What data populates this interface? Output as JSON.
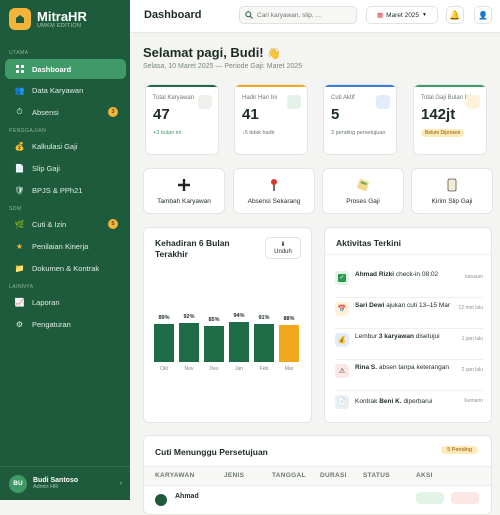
{
  "brand": {
    "name": "MitraHR",
    "sub": "UMKM EDITION"
  },
  "sidebar": {
    "sections": {
      "main": "UTAMA",
      "payroll": "PENGGAJIAN",
      "hr": "SDM",
      "report": "LAINNYA"
    },
    "items": [
      {
        "label": "Dashboard",
        "icon": "grid-icon"
      },
      {
        "label": "Data Karyawan",
        "icon": "users-icon"
      },
      {
        "label": "Absensi",
        "icon": "clock-icon",
        "badge": "3"
      },
      {
        "label": "Kalkulasi Gaji",
        "icon": "money-bag-icon"
      },
      {
        "label": "Slip Gaji",
        "icon": "document-icon"
      },
      {
        "label": "BPJS & PPh21",
        "icon": "shield-icon"
      },
      {
        "label": "Cuti & Izin",
        "icon": "leaf-icon",
        "badge": "5"
      },
      {
        "label": "Penilaian Kinerja",
        "icon": "star-icon"
      },
      {
        "label": "Dokumen & Kontrak",
        "icon": "folder-icon"
      },
      {
        "label": "Laporan",
        "icon": "chart-icon"
      },
      {
        "label": "Pengaturan",
        "icon": "gear-icon"
      }
    ],
    "user": {
      "initials": "BU",
      "name": "Budi Santoso",
      "role": "Admin HR"
    }
  },
  "header": {
    "title": "Dashboard",
    "search_placeholder": "Cari karyawan, slip, ...",
    "period": "Maret 2025"
  },
  "greeting": {
    "title": "Selamat pagi, Budi!",
    "sub": "Selasa, 10 Maret 2025 — Periode Gaji: Maret 2025"
  },
  "stats": [
    {
      "label": "Total Karyawan",
      "value": "47",
      "note": "+3 bulan ini",
      "color": "#1e6b47"
    },
    {
      "label": "Hadir Hari Ini",
      "value": "41",
      "note": "6 tidak hadir",
      "color": "#f2a81d"
    },
    {
      "label": "Cuti Aktif",
      "value": "5",
      "note": "3 pending persetujuan",
      "color": "#3a7bd5"
    },
    {
      "label": "Total Gaji Bulan Ini",
      "value": "142jt",
      "note": "Belum Diproses",
      "color": "#3f9a68"
    }
  ],
  "quick_actions": [
    {
      "label": "Tambah Karyawan",
      "icon": "plus-icon"
    },
    {
      "label": "Absensi Sekarang",
      "icon": "pin-icon"
    },
    {
      "label": "Proses Gaji",
      "icon": "calculator-icon"
    },
    {
      "label": "Kirim Slip Gaji",
      "icon": "scroll-icon"
    }
  ],
  "attendance": {
    "title_1": "Kehadiran 6 Bulan",
    "title_2": "Terakhir",
    "download_label": "Unduh",
    "download_icon": "download-icon"
  },
  "chart_data": {
    "type": "bar",
    "categories": [
      "Okt",
      "Nov",
      "Des",
      "Jan",
      "Feb",
      "Mar"
    ],
    "values": [
      89,
      92,
      85,
      94,
      91,
      88
    ],
    "labels": [
      "89%",
      "92%",
      "85%",
      "94%",
      "91%",
      "88%"
    ],
    "highlight": "Mar",
    "ylim": [
      0,
      100
    ]
  },
  "activity": {
    "title": "Aktivitas Terkini",
    "items": [
      {
        "name": "Ahmad Rizki",
        "text": "check-in 08:02",
        "time": "barusan",
        "icon": "check-icon",
        "bg": "#e3f3e8"
      },
      {
        "name": "Sari Dewi",
        "text": "ajukan cuti 13–15 Mar",
        "time": "12 mnt lalu",
        "icon": "calendar-icon",
        "bg": "#fff2d9"
      },
      {
        "name": "",
        "text_pre": "Lembur",
        "name2": "3 karyawan",
        "text": "disetujui",
        "time": "1 jam lalu",
        "icon": "money-bag-icon",
        "bg": "#e3ecfa"
      },
      {
        "name": "Rina S.",
        "text": "absen tanpa keterangan",
        "time": "2 jam lalu",
        "icon": "warning-icon",
        "bg": "#fde6e6"
      },
      {
        "name": "Beni K.",
        "text_pre": "Kontrak",
        "text": "diperbarui",
        "time": "Kemarin",
        "icon": "document-icon",
        "bg": "#eceef0"
      }
    ]
  },
  "leave": {
    "title": "Cuti Menunggu Persetujuan",
    "badge": "5 Pending",
    "columns": [
      "KARYAWAN",
      "JENIS",
      "TANGGAL",
      "DURASI",
      "STATUS",
      "AKSI"
    ],
    "first_row_name": "Ahmad"
  }
}
